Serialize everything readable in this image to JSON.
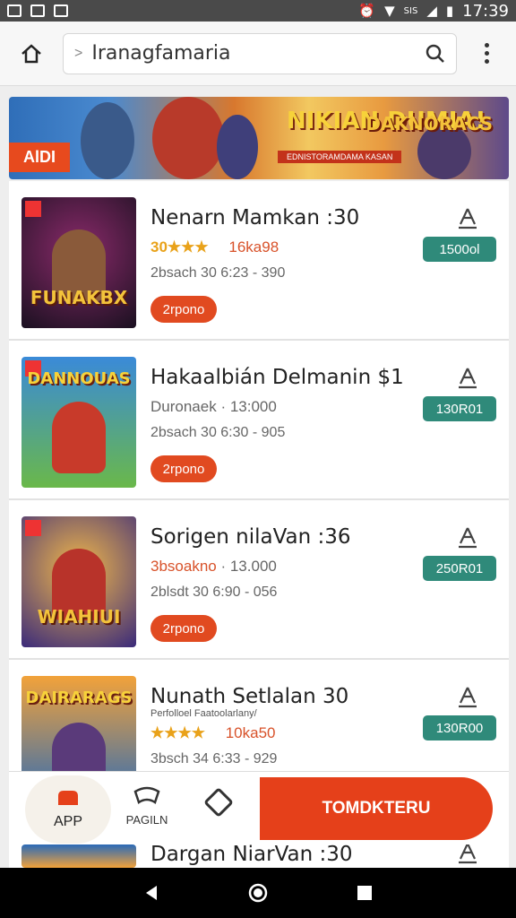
{
  "status_bar": {
    "time": "17:39",
    "signal_text": "SIS",
    "icons": [
      "photo-icon",
      "bag-icon",
      "image-icon",
      "alarm-icon",
      "wifi-icon",
      "signal-icon",
      "battery-icon"
    ]
  },
  "browser": {
    "url": "Iranagfamaria",
    "icons": [
      "home-icon",
      "chevron-right-icon",
      "search-icon",
      "more-vert-icon"
    ]
  },
  "banner": {
    "tag": "AlDI",
    "center_title": "NIKIAN DUMIA!",
    "center_sub": "EDNISTORAMDAMA KASAN",
    "right_title": "DAKNORACS"
  },
  "apps": [
    {
      "title": "Nenarn Mamkan :30",
      "meta_a": "30★★★",
      "meta_b": "16ka98",
      "meta_line2": "2bsach 30 6:23 - 390",
      "pill": "2rpono",
      "price": "1500ol",
      "thumb_label": "FUNAKBX",
      "thumb_top": ""
    },
    {
      "title": "Hakaalbián Delmanin   $1",
      "meta_a": "Duronaek",
      "meta_b": "· 13:000",
      "meta_line2": "2bsach 30 6:30 - 905",
      "pill": "2rpono",
      "price": "130R01",
      "thumb_label": "",
      "thumb_top": "DANNOUAS"
    },
    {
      "title": "Sorigen nilaVan :36",
      "meta_a": "3bsoakno",
      "meta_b": "· 13.000",
      "meta_line2": "2blsdt 30 6:90 - 056",
      "pill": "2rpono",
      "price": "250R01",
      "thumb_label": "WIAHIUI",
      "thumb_top": ""
    },
    {
      "title": "Nunath Setlalan 30",
      "meta_sub": "Perfolloel Faatoolarlany/",
      "meta_a": "★★★★",
      "meta_b": "10ka50",
      "meta_line2": "3bsch 34 6:33 - 929",
      "price": "130R00",
      "thumb_label": "",
      "thumb_top": "DAIRARAGS"
    }
  ],
  "partial_row": {
    "title": "Dargan NiarVan :30"
  },
  "bottom_nav": {
    "app_label": "APP",
    "pad_label": "PAGILN",
    "cta_label": "TOMDKTERU"
  },
  "colors": {
    "accent": "#e5401a",
    "price": "#2f8a7a",
    "star": "#e9a21a"
  }
}
